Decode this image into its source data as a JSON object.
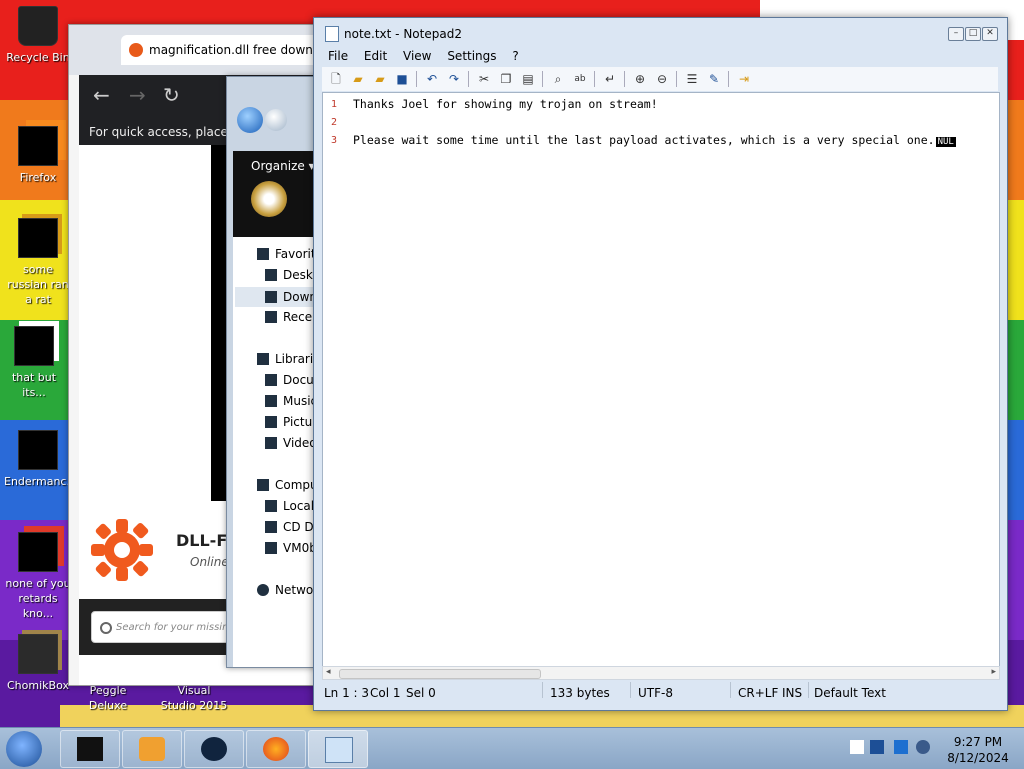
{
  "desktop": {
    "icons": [
      {
        "label": "Recycle Bin",
        "icon": "recycle-bin-icon"
      },
      {
        "label": "Firefox",
        "icon": "firefox-icon"
      },
      {
        "label": "some russian ran a rat",
        "icon": "app-icon"
      },
      {
        "label": "that but its...",
        "icon": "files-icon"
      },
      {
        "label": "Endermanc...",
        "icon": "window-icon"
      },
      {
        "label": "none of you retards kno...",
        "icon": "app-icon"
      },
      {
        "label": "ChomikBox",
        "icon": "chomikbox-icon"
      },
      {
        "label": "Peggle Deluxe",
        "icon": "peggle-icon"
      },
      {
        "label": "Visual Studio 2015",
        "icon": "visual-studio-icon"
      }
    ]
  },
  "browser": {
    "tab_title": "magnification.dll free downloa",
    "quick_access_text": "For quick access, place yo",
    "site_title": "DLL-FI",
    "site_subtitle": "Online",
    "search_placeholder": "Search for your missing"
  },
  "explorer": {
    "organize_label": "Organize ▾",
    "tree": [
      {
        "label": "Favorite",
        "indent": 0
      },
      {
        "label": "Deskt",
        "indent": 1
      },
      {
        "label": "Down",
        "indent": 1,
        "selected": true
      },
      {
        "label": "Recer",
        "indent": 1
      },
      {
        "label": "Librarie",
        "indent": 0
      },
      {
        "label": "Docu",
        "indent": 1
      },
      {
        "label": "Music",
        "indent": 1
      },
      {
        "label": "Pictu",
        "indent": 1
      },
      {
        "label": "Video",
        "indent": 1
      },
      {
        "label": "Compu",
        "indent": 0
      },
      {
        "label": "Local",
        "indent": 1
      },
      {
        "label": "CD D",
        "indent": 1
      },
      {
        "label": "VM0b",
        "indent": 1
      },
      {
        "label": "Networ",
        "indent": 0
      }
    ]
  },
  "notepad": {
    "title": "note.txt - Notepad2",
    "menu": [
      "File",
      "Edit",
      "View",
      "Settings",
      "?"
    ],
    "lines": [
      {
        "num": "1",
        "text": "Thanks Joel for showing my trojan on stream!"
      },
      {
        "num": "2",
        "text": ""
      },
      {
        "num": "3",
        "text": "Please wait some time until the last payload activates, which is a very special one."
      }
    ],
    "nul_marker": "NUL",
    "status": {
      "position": "Ln 1 : 3",
      "col": "Col 1",
      "sel": "Sel 0",
      "size": "133 bytes",
      "encoding": "UTF-8",
      "eol": "CR+LF",
      "mode": "INS",
      "scheme": "Default Text"
    }
  },
  "taskbar": {
    "time": "9:27 PM",
    "date": "8/12/2024"
  },
  "colors": {
    "notepad_line_number": "#c0392b",
    "taskbar": "#a8c0da"
  }
}
